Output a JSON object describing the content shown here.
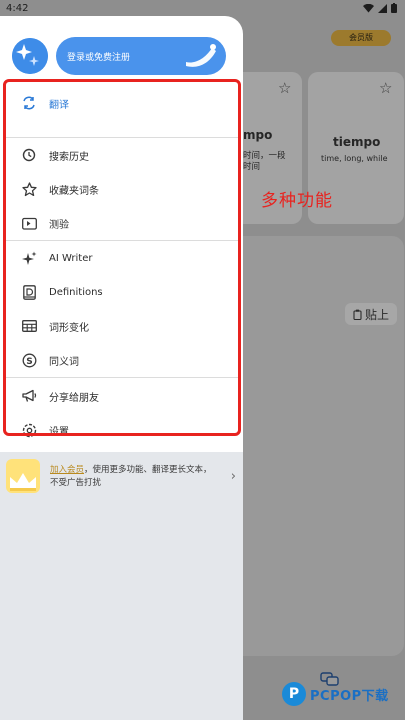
{
  "status_bar": {
    "time": "4:42"
  },
  "background": {
    "member_badge": "会员版",
    "card1": {
      "title": "mpo",
      "line1": "时间，一段",
      "line2": "时间"
    },
    "card2": {
      "title": "tiempo",
      "subtitle": "time, long, while"
    },
    "paste_label": "贴上"
  },
  "drawer": {
    "login_label": "登录或免费注册",
    "menu": [
      {
        "label": "翻译",
        "icon": "translate-icon",
        "active": true
      },
      {
        "label": "搜索历史",
        "icon": "history-icon"
      },
      {
        "label": "收藏夹词条",
        "icon": "star-icon"
      },
      {
        "label": "测验",
        "icon": "quiz-cards-icon"
      },
      {
        "label": "AI Writer",
        "icon": "sparkle-icon"
      },
      {
        "label": "Definitions",
        "icon": "dictionary-icon"
      },
      {
        "label": "词形变化",
        "icon": "table-icon"
      },
      {
        "label": "同义词",
        "icon": "synonym-icon"
      },
      {
        "label": "分享给朋友",
        "icon": "megaphone-icon"
      },
      {
        "label": "设置",
        "icon": "settings-icon"
      }
    ],
    "promo": {
      "link_text": "加入会员",
      "text": "，使用更多功能、翻译更长文本，不受广告打扰"
    }
  },
  "annotation": "多种功能",
  "watermark": {
    "text": "PCPOP下载",
    "mark": "P"
  },
  "colors": {
    "accent": "#4a93ec",
    "highlight": "#e8231f",
    "active_text": "#2a79d6"
  }
}
